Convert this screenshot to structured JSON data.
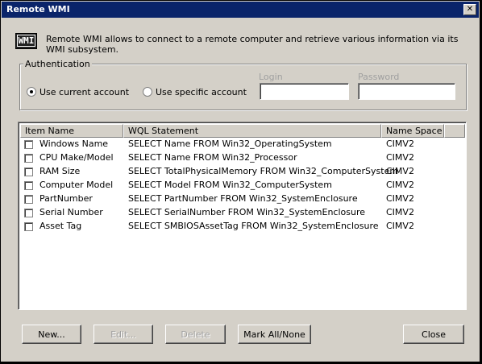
{
  "window": {
    "title": "Remote WMI",
    "close_glyph": "✕"
  },
  "header": {
    "logo_text": "WMI",
    "description": "Remote WMI allows to connect to a remote computer and retrieve various information via its WMI subsystem."
  },
  "authentication": {
    "group_label": "Authentication",
    "option_current": "Use current account",
    "option_specific": "Use specific account",
    "selected": "current",
    "login_label": "Login",
    "login_value": "",
    "password_label": "Password",
    "password_value": ""
  },
  "table": {
    "columns": [
      "Item Name",
      "WQL Statement",
      "Name Space"
    ],
    "rows": [
      {
        "name": "Windows Name",
        "wql": "SELECT Name FROM Win32_OperatingSystem",
        "ns": "CIMV2",
        "checked": false
      },
      {
        "name": "CPU Make/Model",
        "wql": "SELECT Name FROM Win32_Processor",
        "ns": "CIMV2",
        "checked": false
      },
      {
        "name": "RAM Size",
        "wql": "SELECT TotalPhysicalMemory FROM Win32_ComputerSystem",
        "ns": "CIMV2",
        "checked": false
      },
      {
        "name": "Computer Model",
        "wql": "SELECT Model FROM Win32_ComputerSystem",
        "ns": "CIMV2",
        "checked": false
      },
      {
        "name": "PartNumber",
        "wql": "SELECT PartNumber FROM Win32_SystemEnclosure",
        "ns": "CIMV2",
        "checked": false
      },
      {
        "name": "Serial Number",
        "wql": "SELECT SerialNumber FROM Win32_SystemEnclosure",
        "ns": "CIMV2",
        "checked": false
      },
      {
        "name": "Asset Tag",
        "wql": "SELECT SMBIOSAssetTag FROM Win32_SystemEnclosure",
        "ns": "CIMV2",
        "checked": false
      }
    ]
  },
  "buttons": {
    "new": "New...",
    "edit": "Edit...",
    "delete": "Delete",
    "mark_all": "Mark All/None",
    "close": "Close"
  }
}
